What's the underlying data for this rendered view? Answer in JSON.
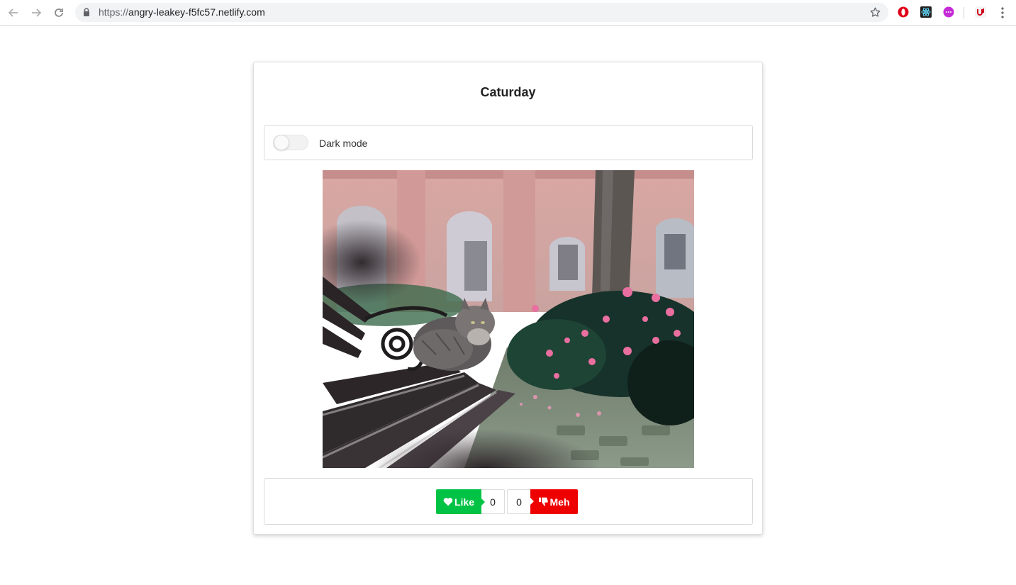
{
  "browser": {
    "url_scheme": "https://",
    "url_host": "angry-leakey-f5fc57.netlify.com",
    "icons": {
      "back": "arrow-left-icon",
      "forward": "arrow-right-icon",
      "reload": "reload-icon",
      "lock": "lock-icon",
      "bookmark": "star-icon",
      "menu": "more-vertical-icon"
    },
    "extensions": [
      "opera-icon",
      "react-devtools-icon",
      "purple-extension-icon",
      "red-extension-icon"
    ]
  },
  "card": {
    "title": "Caturday",
    "dark_mode": {
      "label": "Dark mode",
      "enabled": false
    },
    "image": {
      "description_icon": "cat-photo"
    },
    "actions": {
      "like_label": "Like",
      "like_count": "0",
      "meh_count": "0",
      "meh_label": "Meh"
    }
  },
  "colors": {
    "like": "#00c244",
    "meh": "#ee0000"
  }
}
